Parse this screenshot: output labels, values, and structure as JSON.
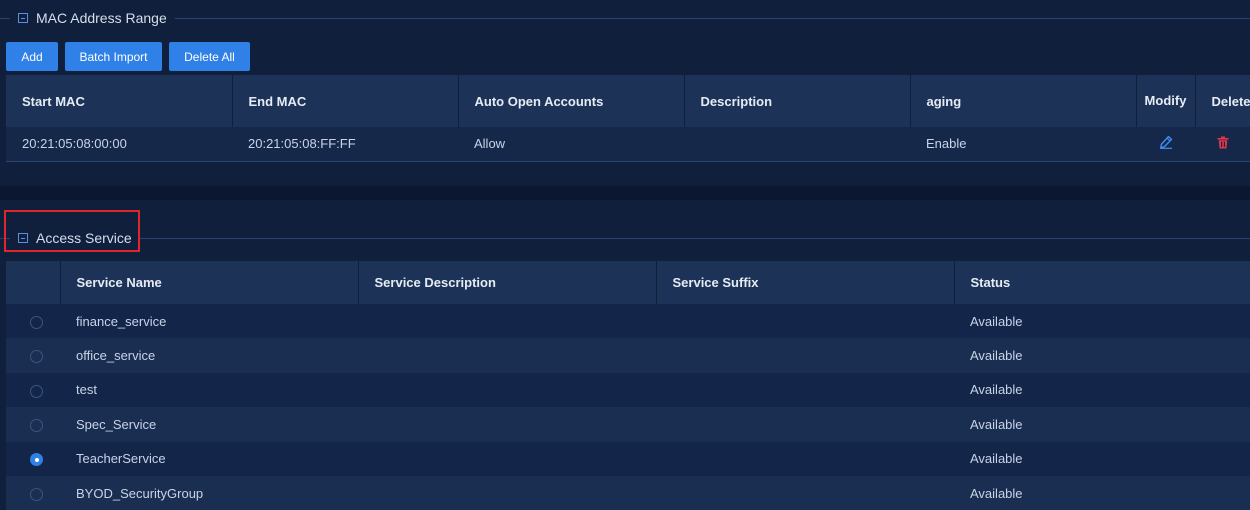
{
  "mac_section": {
    "title": "MAC Address Range",
    "buttons": {
      "add": "Add",
      "batch_import": "Batch Import",
      "delete_all": "Delete All"
    },
    "columns": [
      "Start MAC",
      "End MAC",
      "Auto Open Accounts",
      "Description",
      "aging",
      "Modify",
      "Delete"
    ],
    "rows": [
      {
        "start_mac": "20:21:05:08:00:00",
        "end_mac": "20:21:05:08:FF:FF",
        "auto_open": "Allow",
        "description": "",
        "aging": "Enable",
        "modify_icon": "pencil-icon",
        "delete_icon": "trash-icon"
      }
    ]
  },
  "access_section": {
    "title": "Access Service",
    "columns": [
      "Service Name",
      "Service Description",
      "Service Suffix",
      "Status"
    ],
    "rows": [
      {
        "name": "finance_service",
        "description": "",
        "suffix": "",
        "status": "Available",
        "selected": false
      },
      {
        "name": "office_service",
        "description": "",
        "suffix": "",
        "status": "Available",
        "selected": false
      },
      {
        "name": "test",
        "description": "",
        "suffix": "",
        "status": "Available",
        "selected": false
      },
      {
        "name": "Spec_Service",
        "description": "",
        "suffix": "",
        "status": "Available",
        "selected": false
      },
      {
        "name": "TeacherService",
        "description": "",
        "suffix": "",
        "status": "Available",
        "selected": true
      },
      {
        "name": "BYOD_SecurityGroup",
        "description": "",
        "suffix": "",
        "status": "Available",
        "selected": false
      }
    ]
  },
  "colors": {
    "accent": "#2f80e7",
    "edit_icon": "#3d8ef0",
    "delete_icon": "#e0364a",
    "highlight": "#e0252b"
  }
}
